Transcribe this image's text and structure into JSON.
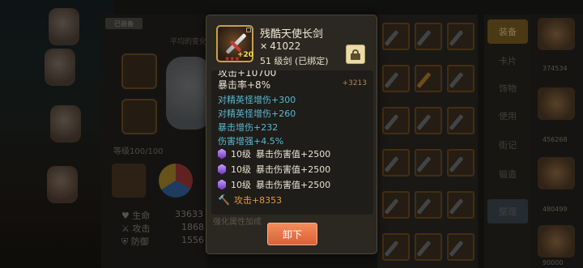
{
  "background": {
    "left_panel": {
      "slot_label": "已装备",
      "title_faded": "平均的变化",
      "level_text": "等级100/100",
      "stats": [
        {
          "icon": "heart-icon",
          "label": "生命",
          "value": "33633"
        },
        {
          "icon": "sword-icon",
          "label": "攻击",
          "value": "1868"
        },
        {
          "icon": "shield-icon",
          "label": "防御",
          "value": "1556"
        }
      ]
    },
    "bag_tabs": [
      "装备",
      "卡片",
      "饰物",
      "使用",
      "街记",
      "锻造",
      "整理"
    ],
    "pet_values": [
      "374534",
      "456268",
      "480499",
      "90000"
    ]
  },
  "popup": {
    "item_name": "残酷天使长剑",
    "power_icon": "crossed-swords-icon",
    "power": "41022",
    "level_line": "51 级剑 (已绑定)",
    "icon_badge": "+20",
    "cut_line": "攻击+10700",
    "crit_line": "暴击率+8%",
    "crit_diff": "+3213",
    "blue_lines": [
      "对精英怪增伤+300",
      "对精英怪增伤+260",
      "暴击增伤+232",
      "伤害增强+4.5%"
    ],
    "gems": [
      {
        "level": "10级",
        "text": "暴击伤害值+2500"
      },
      {
        "level": "10级",
        "text": "暴击伤害值+2500"
      },
      {
        "level": "10级",
        "text": "暴击伤害值+2500"
      }
    ],
    "forge_line": "攻击+8353",
    "faded_bottom": "强化属性加成",
    "unequip_label": "卸下"
  },
  "colors": {
    "accent_blue": "#56b9d4",
    "forge_orange": "#e9963a",
    "button_orange": "#e56f45",
    "gem_purple": "#8a4fd6"
  }
}
